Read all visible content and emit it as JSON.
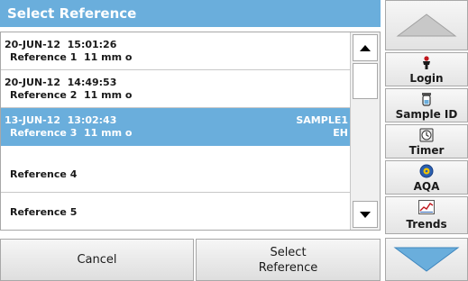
{
  "title": "Select Reference",
  "list": {
    "items": [
      {
        "line1": "20-JUN-12  15:01:26",
        "line2": "Reference 1  11 mm o",
        "right1": "",
        "right2": "",
        "selected": false
      },
      {
        "line1": "20-JUN-12  14:49:53",
        "line2": "Reference 2  11 mm o",
        "right1": "",
        "right2": "",
        "selected": false
      },
      {
        "line1": "13-JUN-12  13:02:43",
        "line2": "Reference 3  11 mm o",
        "right1": "SAMPLE1",
        "right2": "EH",
        "selected": true
      },
      {
        "label": "Reference 4",
        "selected": false
      },
      {
        "label": "Reference 5",
        "selected": false
      }
    ]
  },
  "buttons": {
    "cancel": "Cancel",
    "select_reference": "Select\nReference"
  },
  "side_menu": {
    "login": "Login",
    "sample_id": "Sample ID",
    "timer": "Timer",
    "aqa": "AQA",
    "trends": "Trends"
  },
  "colors": {
    "accent": "#6aaedc",
    "arrow": "#6aaedc"
  }
}
